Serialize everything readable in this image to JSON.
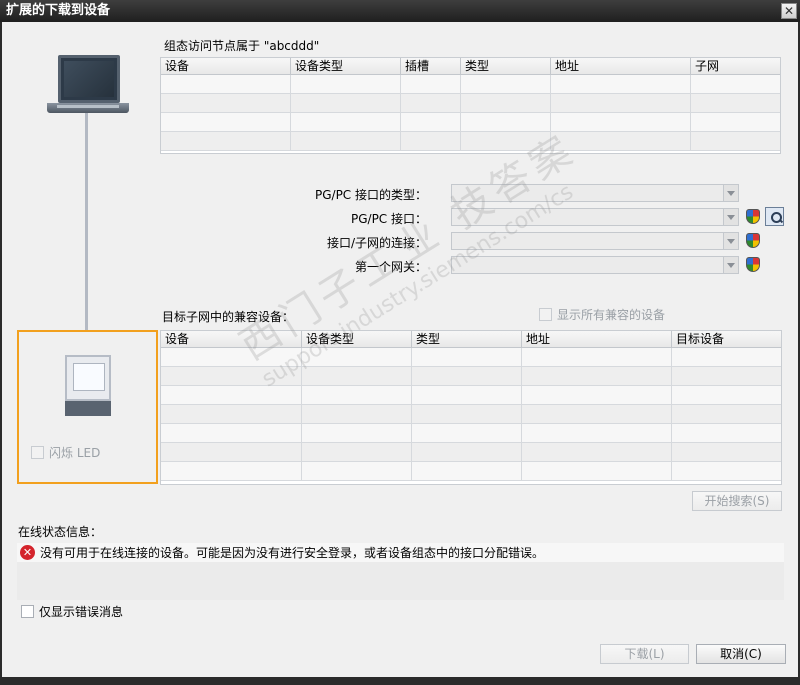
{
  "window": {
    "title": "扩展的下载到设备",
    "close_glyph": "✕"
  },
  "config_table": {
    "caption": "组态访问节点属于 \"abcddd\"",
    "columns": [
      "设备",
      "设备类型",
      "插槽",
      "类型",
      "地址",
      "子网"
    ],
    "rows": 4
  },
  "interface_form": {
    "pgpc_type_label": "PG/PC 接口的类型：",
    "pgpc_type_value": "",
    "pgpc_interface_label": "PG/PC 接口：",
    "pgpc_interface_value": "",
    "subnet_connection_label": "接口/子网的连接：",
    "subnet_connection_value": "",
    "first_gateway_label": "第一个网关：",
    "first_gateway_value": ""
  },
  "target_device": {
    "flash_led_label": "闪烁 LED"
  },
  "compatible_table": {
    "caption": "目标子网中的兼容设备：",
    "show_all_label": "显示所有兼容的设备",
    "columns": [
      "设备",
      "设备类型",
      "类型",
      "地址",
      "目标设备"
    ],
    "rows": 7
  },
  "buttons": {
    "start_search": "开始搜索(S)",
    "download": "下载(L)",
    "cancel": "取消(C)"
  },
  "status": {
    "caption": "在线状态信息：",
    "message": "没有可用于在线连接的设备。可能是因为没有进行安全登录，或者设备组态中的接口分配错误。",
    "errors_only_label": "仅显示错误消息"
  },
  "watermark": {
    "line1": "西门子工业   技答案",
    "line2": "support.industry.siemens.com/cs"
  },
  "colors": {
    "target_highlight": "#f2a01e",
    "error": "#d4242c",
    "titlebar": "#2b2b2b"
  }
}
